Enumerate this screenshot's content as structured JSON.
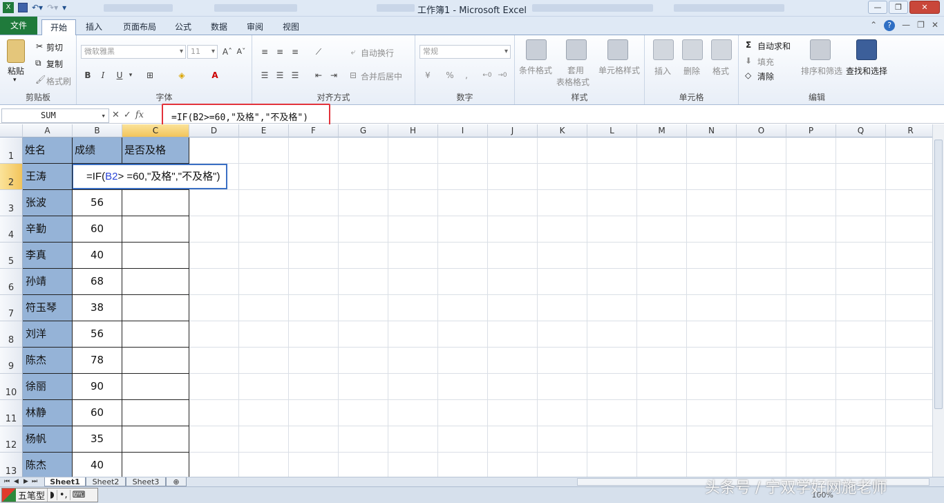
{
  "window": {
    "title": "工作簿1 - Microsoft Excel",
    "controls": [
      "minimize",
      "maximize",
      "close"
    ]
  },
  "qat": {
    "icons": [
      "excel-icon",
      "save-icon",
      "undo-icon",
      "redo-icon",
      "customize-icon"
    ]
  },
  "tabs": {
    "file": "文件",
    "items": [
      "开始",
      "插入",
      "页面布局",
      "公式",
      "数据",
      "审阅",
      "视图"
    ],
    "active": "开始"
  },
  "ribbon": {
    "clipboard": {
      "label": "剪贴板",
      "paste": "粘贴",
      "cut": "剪切",
      "copy": "复制",
      "format_painter": "格式刷"
    },
    "font": {
      "label": "字体",
      "font_name": "微软雅黑",
      "font_size": "11",
      "bold": "B",
      "italic": "I",
      "underline": "U",
      "grow": "A",
      "shrink": "A"
    },
    "alignment": {
      "label": "对齐方式",
      "wrap": "自动换行",
      "merge": "合并后居中"
    },
    "number": {
      "label": "数字",
      "format": "常规",
      "percent": "%",
      "comma": ","
    },
    "styles": {
      "label": "样式",
      "conditional": "条件格式",
      "table1": "套用",
      "table2": "表格格式",
      "cell_styles": "单元格样式"
    },
    "cells": {
      "label": "单元格",
      "insert": "插入",
      "delete": "删除",
      "format": "格式"
    },
    "editing": {
      "label": "编辑",
      "autosum": "自动求和",
      "fill": "填充",
      "clear": "清除",
      "sort": "排序和筛选",
      "find": "查找和选择"
    }
  },
  "formula_bar": {
    "name_box": "SUM",
    "cancel": "✕",
    "enter": "✓",
    "fx": "fx",
    "formula": "=IF(B2>=60,\"及格\",\"不及格\")"
  },
  "grid": {
    "columns": [
      "A",
      "B",
      "C",
      "D",
      "E",
      "F",
      "G",
      "H",
      "I",
      "J",
      "K",
      "L",
      "M",
      "N",
      "O",
      "P",
      "Q",
      "R"
    ],
    "selected_column": "C",
    "rows": [
      "1",
      "2",
      "3",
      "4",
      "5",
      "6",
      "7",
      "8",
      "9",
      "10",
      "11",
      "12",
      "13"
    ],
    "selected_row": "2",
    "header": [
      "姓名",
      "成绩",
      "是否及格"
    ],
    "data": [
      {
        "name": "王涛",
        "score": ""
      },
      {
        "name": "张波",
        "score": "56"
      },
      {
        "name": "辛勤",
        "score": "60"
      },
      {
        "name": "李真",
        "score": "40"
      },
      {
        "name": "孙靖",
        "score": "68"
      },
      {
        "name": "符玉琴",
        "score": "38"
      },
      {
        "name": "刘洋",
        "score": "56"
      },
      {
        "name": "陈杰",
        "score": "78"
      },
      {
        "name": "徐丽",
        "score": "90"
      },
      {
        "name": "林静",
        "score": "60"
      },
      {
        "name": "杨帆",
        "score": "35"
      },
      {
        "name": "陈杰",
        "score": "40"
      }
    ],
    "edit_cell": {
      "prefix": "=IF(",
      "ref": "B2",
      "rest": "> =60,\"及格\",\"不及格\")"
    }
  },
  "sheets": {
    "items": [
      "Sheet1",
      "Sheet2",
      "Sheet3"
    ],
    "active": "Sheet1"
  },
  "ime": {
    "mode": "五笔型"
  },
  "status": {
    "zoom": "100%"
  },
  "watermark": "头条号 / 宁双学好网施老师"
}
